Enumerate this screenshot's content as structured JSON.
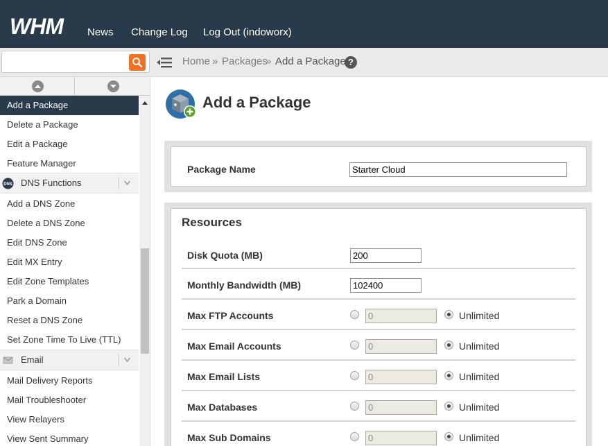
{
  "header": {
    "logo_text": "WHM",
    "nav": [
      "News",
      "Change Log",
      "Log Out (indoworx)"
    ]
  },
  "breadcrumb": {
    "home": "Home",
    "packages": "Packages",
    "separator": "»",
    "current": "Add a Package"
  },
  "search": {
    "value": "",
    "placeholder": ""
  },
  "sidebar": {
    "items_top": [
      "Add a Package",
      "Delete a Package",
      "Edit a Package",
      "Feature Manager"
    ],
    "categories": [
      {
        "label": "DNS Functions",
        "icon": "dns-icon",
        "items": [
          "Add a DNS Zone",
          "Delete a DNS Zone",
          "Edit DNS Zone",
          "Edit MX Entry",
          "Edit Zone Templates",
          "Park a Domain",
          "Reset a DNS Zone",
          "Set Zone Time To Live (TTL)"
        ]
      },
      {
        "label": "Email",
        "icon": "email-icon",
        "items": [
          "Mail Delivery Reports",
          "Mail Troubleshooter",
          "View Relayers",
          "View Sent Summary"
        ]
      }
    ]
  },
  "page": {
    "title": "Add a Package",
    "package_name_label": "Package Name",
    "package_name_value": "Starter Cloud",
    "resources_title": "Resources",
    "disk_quota_label": "Disk Quota (MB)",
    "disk_quota_value": "200",
    "bandwidth_label": "Monthly Bandwidth (MB)",
    "bandwidth_value": "102400",
    "unlimited_label": "Unlimited",
    "limit_rows": [
      {
        "label": "Max FTP Accounts",
        "value": "0"
      },
      {
        "label": "Max Email Accounts",
        "value": "0"
      },
      {
        "label": "Max Email Lists",
        "value": "0"
      },
      {
        "label": "Max Databases",
        "value": "0"
      },
      {
        "label": "Max Sub Domains",
        "value": "0"
      }
    ]
  },
  "colors": {
    "header_bg": "#293a4a",
    "search_button": "#f26f21",
    "active_nav": "#293a4a"
  }
}
